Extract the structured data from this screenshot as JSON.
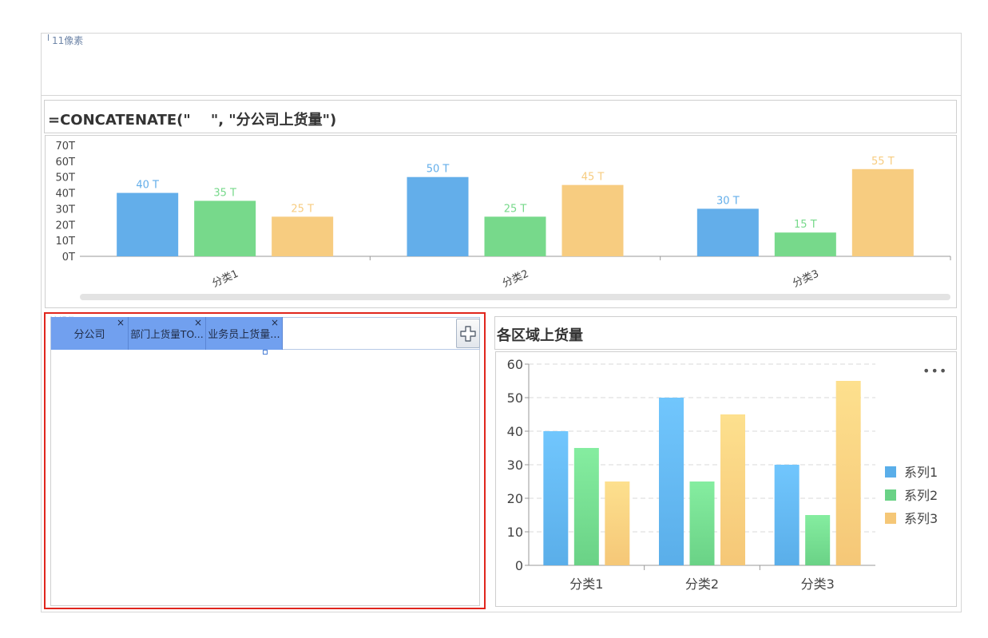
{
  "canvas": {
    "pixel_label": "11像素"
  },
  "chart1": {
    "title": "=CONCATENATE(\"    \", \"分公司上货量\")",
    "chart_data": {
      "type": "bar",
      "categories": [
        "分类1",
        "分类2",
        "分类3"
      ],
      "series": [
        {
          "values": [
            40,
            50,
            30
          ],
          "color": "#63aeea"
        },
        {
          "values": [
            35,
            25,
            15
          ],
          "color": "#77d98b"
        },
        {
          "values": [
            25,
            45,
            55
          ],
          "color": "#f7cc80"
        }
      ],
      "value_suffix": " T",
      "ylim": [
        0,
        70
      ],
      "yticks": [
        "0T",
        "10T",
        "20T",
        "30T",
        "40T",
        "50T",
        "60T",
        "70T"
      ],
      "grid": false,
      "legend": "none"
    }
  },
  "widget": {
    "hint": "该组件",
    "tabs": [
      {
        "label": "分公司",
        "close": "×"
      },
      {
        "label": "部门上货量TO...",
        "close": "×"
      },
      {
        "label": "业务员上货量...",
        "close": "×"
      }
    ],
    "add_icon": "plus-icon"
  },
  "chart2": {
    "title": "各区域上货量",
    "more_icon": "•••",
    "chart_data": {
      "type": "bar",
      "categories": [
        "分类1",
        "分类2",
        "分类3"
      ],
      "series": [
        {
          "name": "系列1",
          "values": [
            40,
            50,
            30
          ],
          "color_top": "#71c6fd",
          "color_bottom": "#5aaee9"
        },
        {
          "name": "系列2",
          "values": [
            35,
            25,
            15
          ],
          "color_top": "#85eda0",
          "color_bottom": "#6ad286"
        },
        {
          "name": "系列3",
          "values": [
            25,
            45,
            55
          ],
          "color_top": "#fde08e",
          "color_bottom": "#f5c777"
        }
      ],
      "ylim": [
        0,
        60
      ],
      "yticks": [
        "0",
        "10",
        "20",
        "30",
        "40",
        "50",
        "60"
      ],
      "grid": true,
      "legend": "right"
    }
  }
}
